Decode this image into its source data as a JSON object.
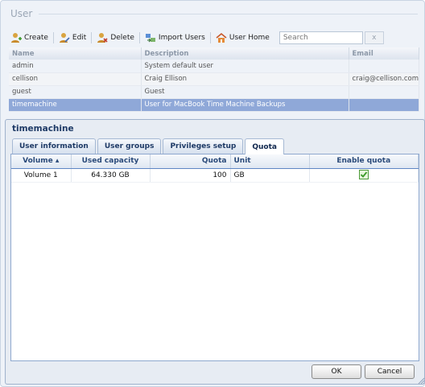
{
  "window": {
    "title": "User"
  },
  "toolbar": {
    "create_label": "Create",
    "edit_label": "Edit",
    "delete_label": "Delete",
    "import_label": "Import Users",
    "home_label": "User Home",
    "search_placeholder": "Search",
    "clear_label": "x"
  },
  "user_table": {
    "headers": [
      "Name",
      "Description",
      "Email"
    ],
    "rows": [
      {
        "name": "admin",
        "description": "System default user",
        "email": ""
      },
      {
        "name": "cellison",
        "description": "Craig Ellison",
        "email": "craig@cellison.com"
      },
      {
        "name": "guest",
        "description": "Guest",
        "email": ""
      },
      {
        "name": "timemachine",
        "description": "User for MacBook Time Machine Backups",
        "email": ""
      }
    ],
    "selected_row": 3
  },
  "dialog": {
    "title": "timemachine",
    "tabs": [
      "User information",
      "User groups",
      "Privileges setup",
      "Quota"
    ],
    "active_tab": "Quota",
    "quota_table": {
      "headers": {
        "volume": "Volume ▴",
        "used": "Used capacity",
        "quota": "Quota",
        "unit": "Unit",
        "enable": "Enable quota"
      },
      "rows": [
        {
          "volume": "Volume 1",
          "used": "64.330 GB",
          "quota": "100",
          "unit": "GB",
          "enabled": true
        }
      ]
    },
    "ok_label": "OK",
    "cancel_label": "Cancel"
  },
  "colors": {
    "accent": "#8fa8d8",
    "dialog_title": "#1e3a66",
    "check_green": "#3c9a2a"
  },
  "icons": [
    "user-create-icon",
    "user-edit-icon",
    "user-delete-icon",
    "import-users-icon",
    "home-icon",
    "checkbox-checked-icon"
  ]
}
